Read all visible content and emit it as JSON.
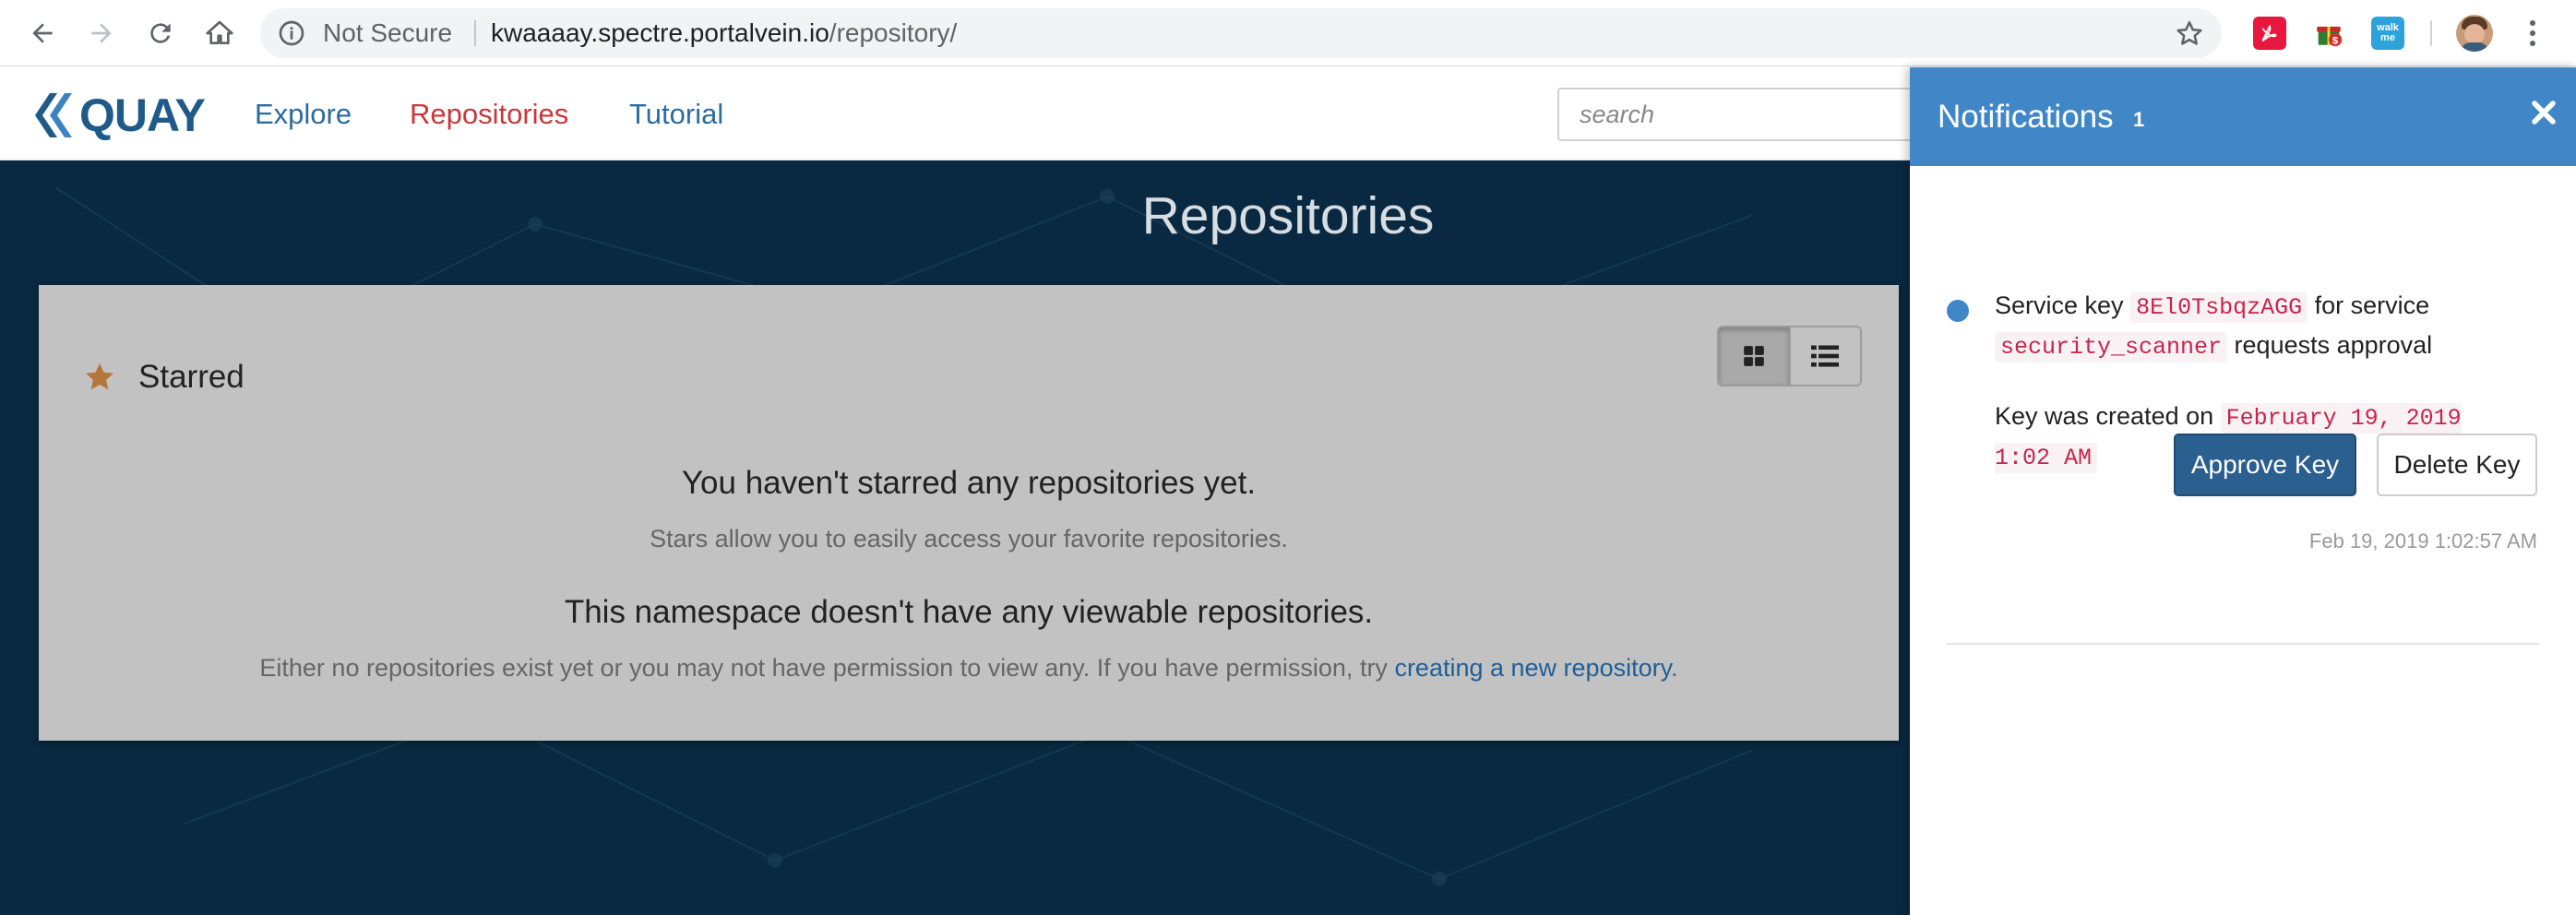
{
  "browser": {
    "security_label": "Not Secure",
    "url_host": "kwaaaay.spectre.portalvein.io",
    "url_path": "/repository/",
    "extensions": [
      "pdf-icon",
      "gift-icon",
      "walkme-icon"
    ],
    "ext3_text": "walk me"
  },
  "navbar": {
    "logo_text": "QUAY",
    "links": [
      "Explore",
      "Repositories",
      "Tutorial"
    ],
    "active_link": "Repositories",
    "search_placeholder": "search"
  },
  "main": {
    "title": "Repositories",
    "starred_label": "Starred",
    "empty_starred_title": "You haven't starred any repositories yet.",
    "empty_starred_sub": "Stars allow you to easily access your favorite repositories.",
    "empty_ns_title": "This namespace doesn't have any viewable repositories.",
    "empty_ns_sub_prefix": "Either no repositories exist yet or you may not have permission to view any. If you have permission, try ",
    "empty_ns_link": "creating a new repository",
    "empty_ns_sub_suffix": "."
  },
  "notifications": {
    "title": "Notifications",
    "count": "1",
    "items": [
      {
        "text_1": "Service key ",
        "key_id": "8El0TsbqzAGG",
        "text_2": " for service ",
        "service": "security_scanner",
        "text_3": " requests approval",
        "created_prefix": "Key was created on ",
        "created_date": "February 19, 2019 1:02 AM",
        "approve_label": "Approve Key",
        "delete_label": "Delete Key",
        "timestamp": "Feb 19, 2019 1:02:57 AM"
      }
    ]
  },
  "colors": {
    "quay_blue": "#1f5a88",
    "active_link": "#c9373a",
    "drawer_header": "#4187c8",
    "approve_button": "#2b5f8f"
  }
}
